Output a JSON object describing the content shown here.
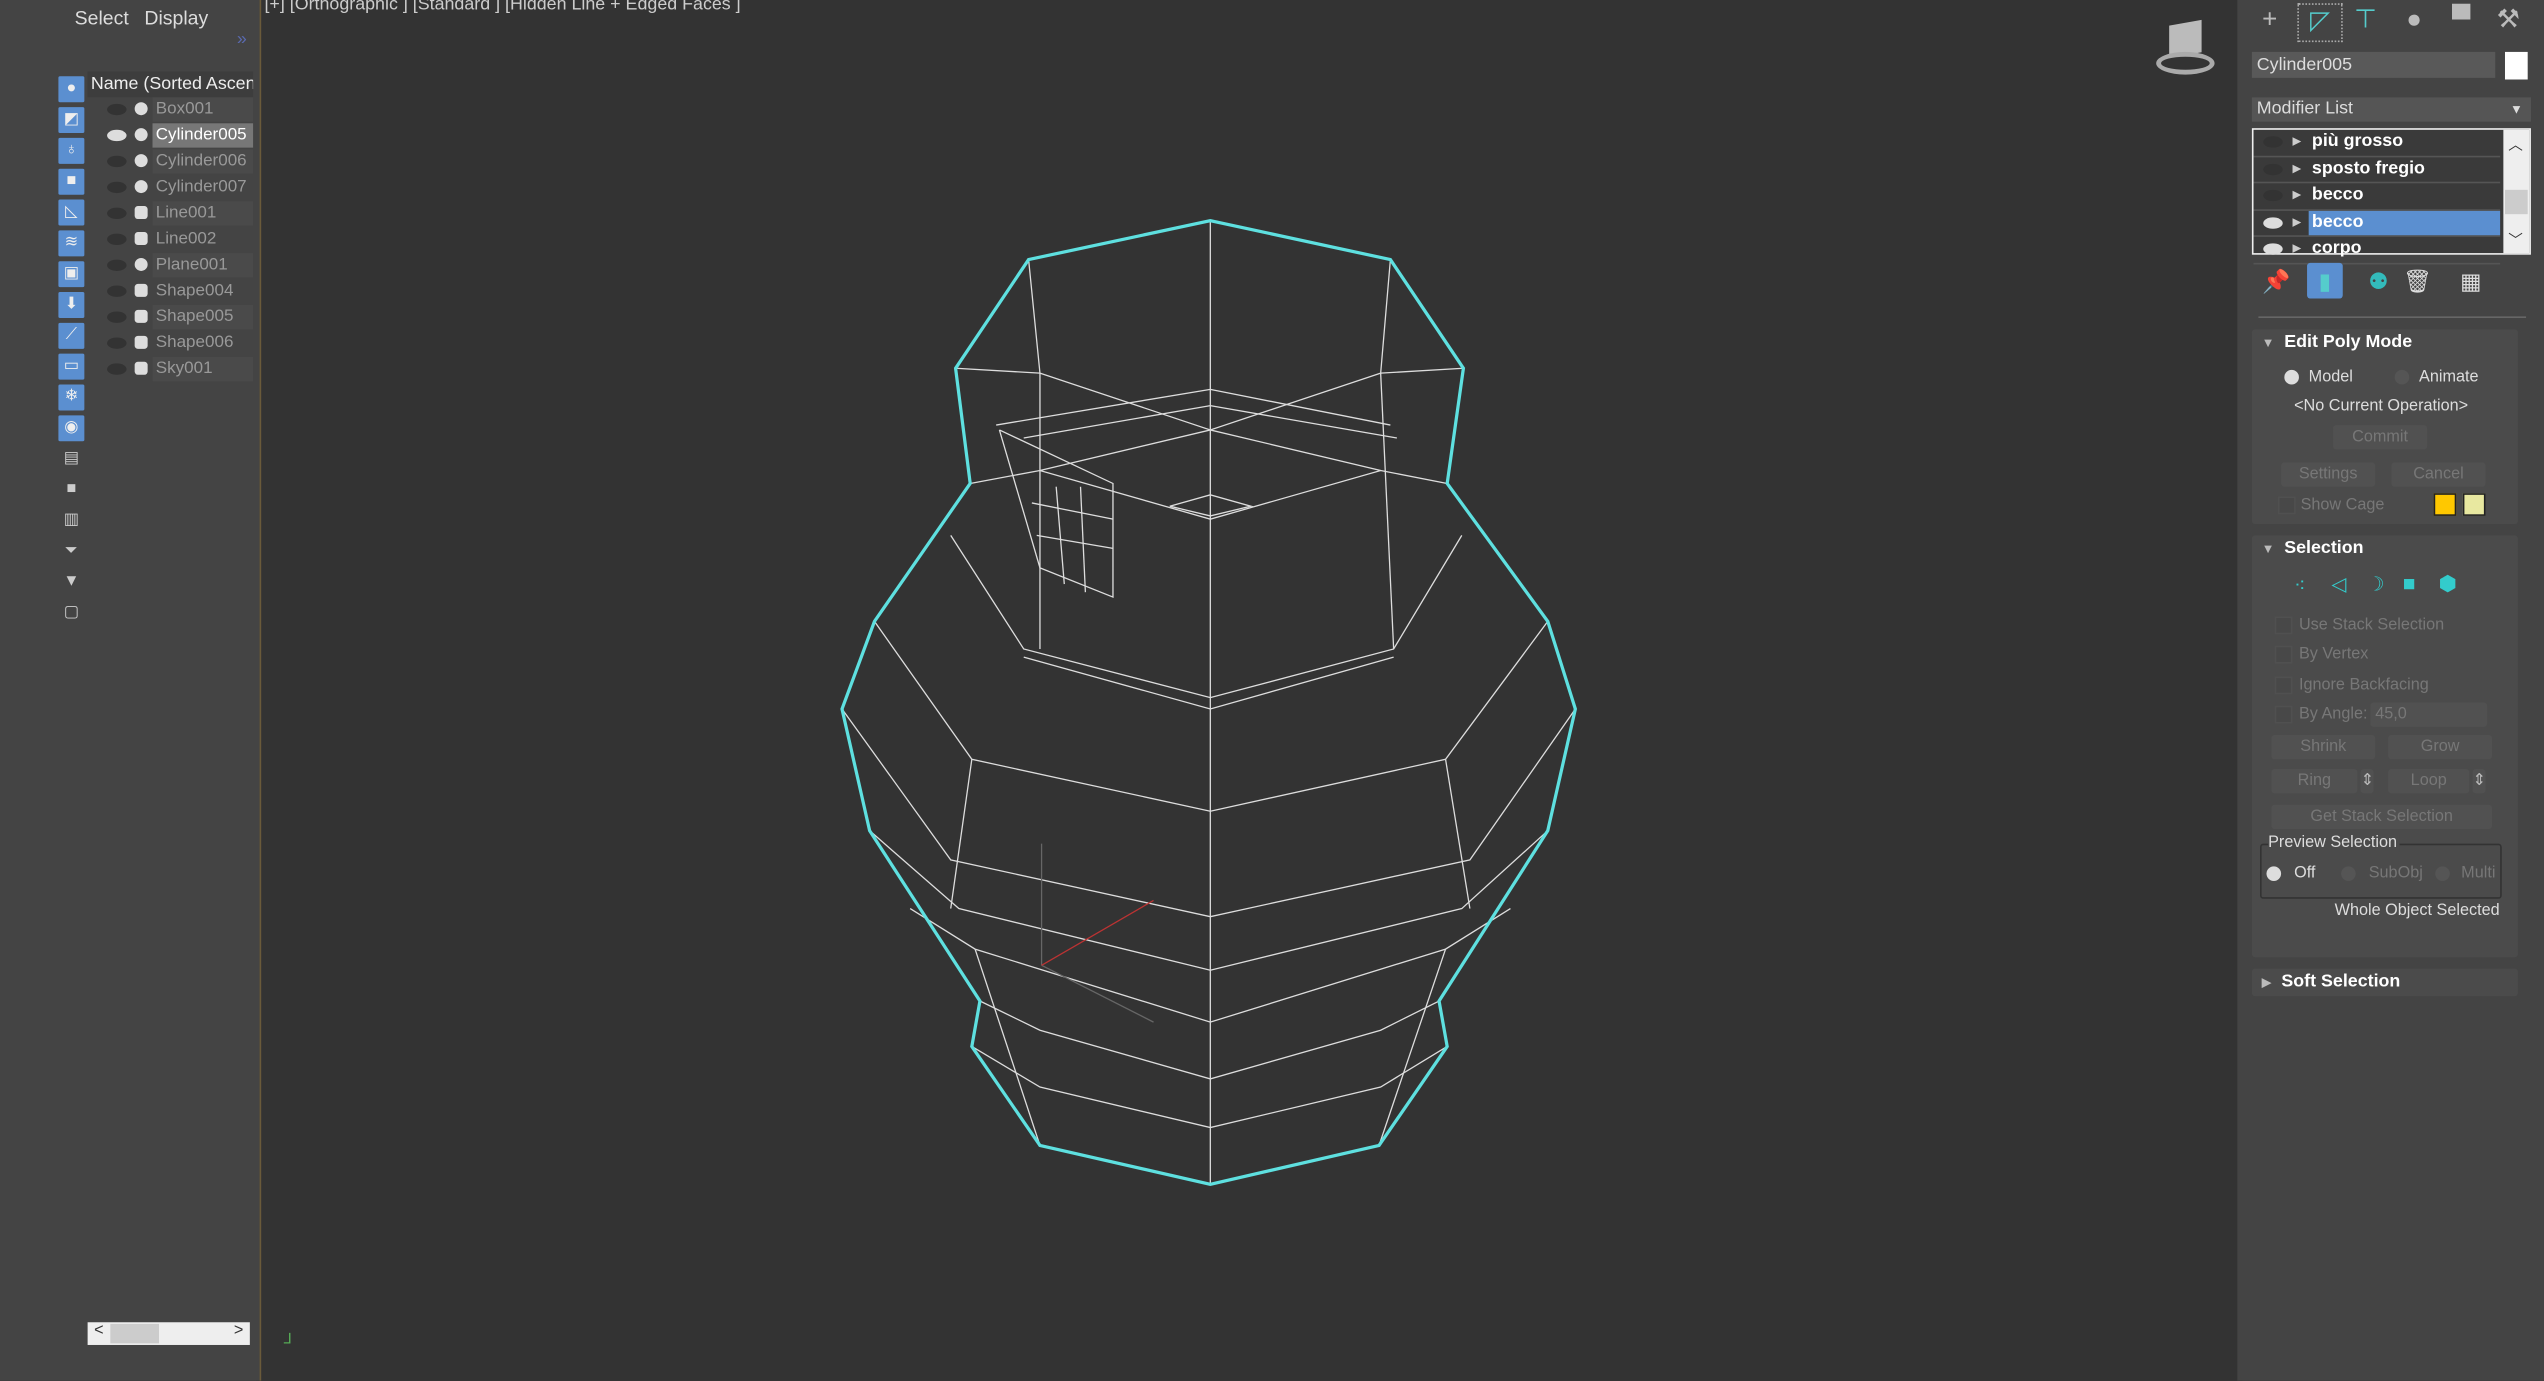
{
  "left_panel": {
    "menu": [
      "Select",
      "Display"
    ],
    "expand": "»",
    "column_header": "Name (Sorted Ascendi",
    "objects": [
      {
        "name": "Box001",
        "visible": false,
        "type": "geometry"
      },
      {
        "name": "Cylinder005",
        "visible": true,
        "type": "geometry",
        "selected": true
      },
      {
        "name": "Cylinder006",
        "visible": false,
        "type": "geometry"
      },
      {
        "name": "Cylinder007",
        "visible": false,
        "type": "geometry"
      },
      {
        "name": "Line001",
        "visible": false,
        "type": "shape"
      },
      {
        "name": "Line002",
        "visible": false,
        "type": "shape"
      },
      {
        "name": "Plane001",
        "visible": false,
        "type": "geometry"
      },
      {
        "name": "Shape004",
        "visible": false,
        "type": "shape"
      },
      {
        "name": "Shape005",
        "visible": false,
        "type": "shape"
      },
      {
        "name": "Shape006",
        "visible": false,
        "type": "shape"
      },
      {
        "name": "Sky001",
        "visible": false,
        "type": "light"
      }
    ],
    "scroll_left": "<",
    "scroll_right": ">"
  },
  "viewport": {
    "label": "[+] [Orthographic ] [Standard ] [Hidden Line + Edged Faces ]",
    "selection_color": "#5ee0e0"
  },
  "right_panel": {
    "object_name": "Cylinder005",
    "object_color": "#ffffff",
    "modifier_list": "Modifier List",
    "stack": [
      {
        "label": "più grosso",
        "visible": false
      },
      {
        "label": "sposto fregio",
        "visible": false
      },
      {
        "label": "becco",
        "visible": false
      },
      {
        "label": "becco",
        "visible": true,
        "selected": true
      },
      {
        "label": "corpo",
        "visible": true
      }
    ],
    "edit_poly_mode": {
      "title": "Edit Poly Mode",
      "model": "Model",
      "animate": "Animate",
      "operation": "<No Current Operation>",
      "commit": "Commit",
      "settings": "Settings",
      "cancel": "Cancel",
      "show_cage": "Show Cage",
      "cage_colors": [
        "#ffc800",
        "#e8e8a0"
      ]
    },
    "selection": {
      "title": "Selection",
      "use_stack": "Use Stack Selection",
      "by_vertex": "By Vertex",
      "ignore_backfacing": "Ignore Backfacing",
      "by_angle": "By Angle:",
      "angle_value": "45,0",
      "shrink": "Shrink",
      "grow": "Grow",
      "ring": "Ring",
      "loop": "Loop",
      "get_stack": "Get Stack Selection",
      "preview": "Preview Selection",
      "off": "Off",
      "subobj": "SubObj",
      "multi": "Multi",
      "status": "Whole Object Selected"
    },
    "soft_selection": {
      "title": "Soft Selection"
    }
  }
}
